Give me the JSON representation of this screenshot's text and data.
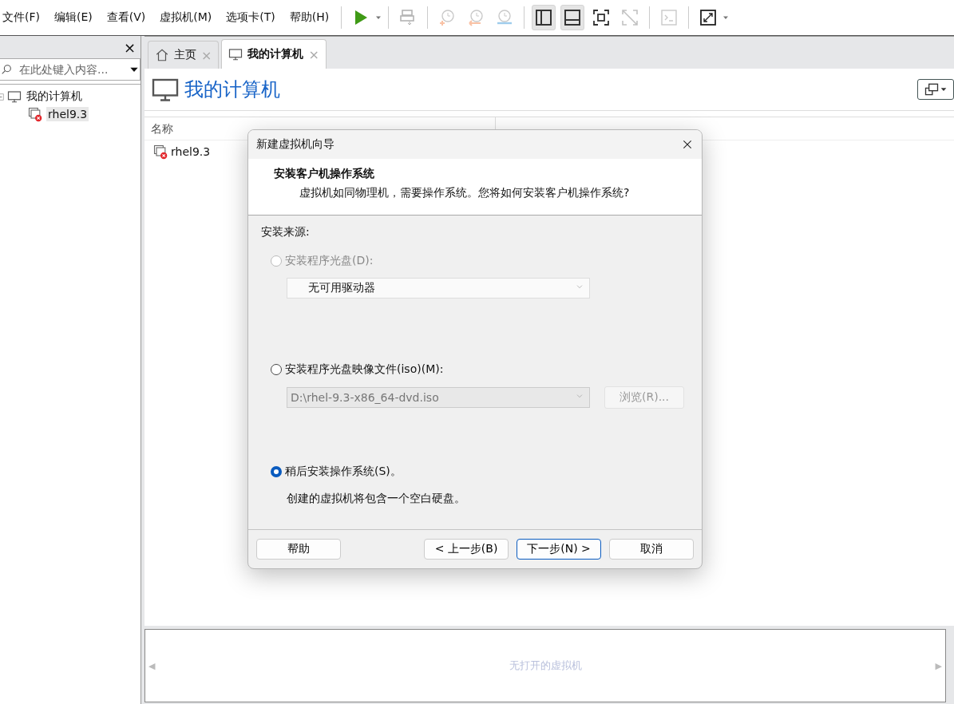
{
  "menu": [
    "文件(F)",
    "编辑(E)",
    "查看(V)",
    "虚拟机(M)",
    "选项卡(T)",
    "帮助(H)"
  ],
  "toolbar": [
    {
      "kind": "play",
      "disabled": false,
      "pressed": false
    },
    {
      "kind": "send",
      "disabled": true,
      "pressed": false
    },
    {
      "kind": "snap-take",
      "disabled": true,
      "pressed": false
    },
    {
      "kind": "snap-revert",
      "disabled": true,
      "pressed": false
    },
    {
      "kind": "snap-manage",
      "disabled": true,
      "pressed": false
    },
    {
      "kind": "sidebar",
      "disabled": false,
      "pressed": true
    },
    {
      "kind": "thumbs",
      "disabled": false,
      "pressed": true
    },
    {
      "kind": "fullscreen",
      "disabled": false,
      "pressed": false
    },
    {
      "kind": "unity",
      "disabled": true,
      "pressed": false
    },
    {
      "kind": "console",
      "disabled": true,
      "pressed": false
    },
    {
      "kind": "stretch",
      "disabled": false,
      "pressed": false
    }
  ],
  "sidebar": {
    "close": "×",
    "search": {
      "placeholder": "在此处键入内容..."
    },
    "tree": [
      {
        "label": "我的计算机",
        "expanded": true,
        "selected": false,
        "children": [
          {
            "label": "rhel9.3",
            "selected": true
          }
        ]
      }
    ]
  },
  "tabs": [
    {
      "label": "主页",
      "kind": "home",
      "selected": false,
      "close": "×"
    },
    {
      "label": "我的计算机",
      "kind": "computer",
      "selected": true,
      "close": "×"
    }
  ],
  "page": {
    "title": "我的计算机",
    "columns": [
      "名称"
    ],
    "rows": [
      {
        "name": "rhel9.3"
      }
    ]
  },
  "dialog": {
    "title": "新建虚拟机向导",
    "heading": "安装客户机操作系统",
    "subheading": "虚拟机如同物理机，需要操作系统。您将如何安装客户机操作系统?",
    "section": "安装来源:",
    "options": [
      {
        "label": "安装程序光盘(D):",
        "selected": false,
        "disabled": true,
        "kind": "drive",
        "value": "无可用驱动器"
      },
      {
        "label": "安装程序光盘映像文件(iso)(M):",
        "selected": false,
        "disabled": false,
        "kind": "iso",
        "value": "D:\\rhel-9.3-x86_64-dvd.iso",
        "browse": "浏览(R)..."
      },
      {
        "label": "稍后安装操作系统(S)。",
        "selected": true,
        "disabled": false,
        "kind": "later",
        "note": "创建的虚拟机将包含一个空白硬盘。"
      }
    ],
    "buttons": [
      {
        "label": "帮助",
        "default": false
      },
      {
        "label": "< 上一步(B)",
        "default": false
      },
      {
        "label": "下一步(N) >",
        "default": true
      },
      {
        "label": "取消",
        "default": false
      }
    ]
  },
  "thumbnails": {
    "left": "◀",
    "empty": "无打开的虚拟机",
    "right": "▶"
  }
}
